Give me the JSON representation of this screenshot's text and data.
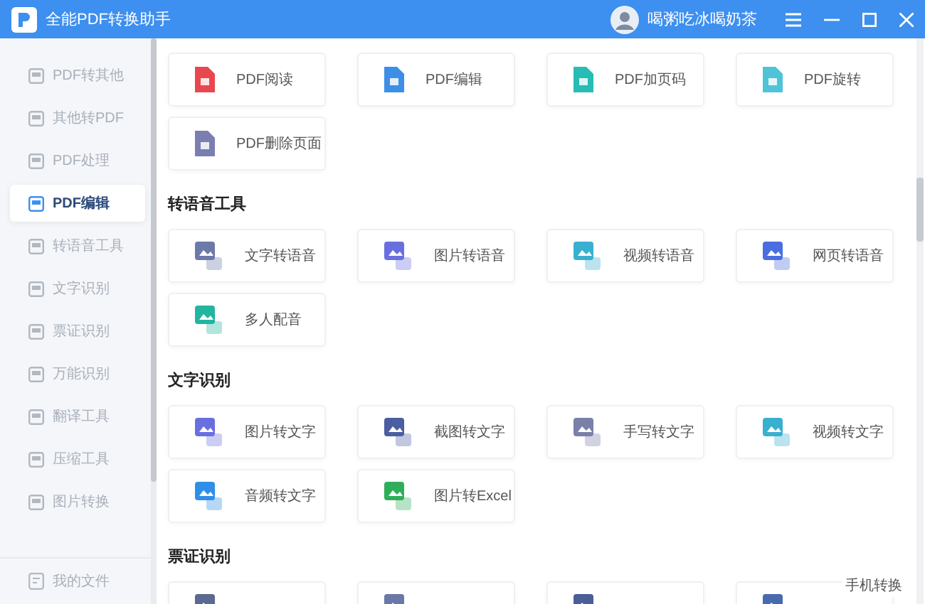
{
  "window": {
    "title": "全能PDF转换助手",
    "user": "喝粥吃冰喝奶茶"
  },
  "sidebar": {
    "items": [
      {
        "label": "PDF转其他",
        "selected": false
      },
      {
        "label": "其他转PDF",
        "selected": false
      },
      {
        "label": "PDF处理",
        "selected": false
      },
      {
        "label": "PDF编辑",
        "selected": true
      },
      {
        "label": "转语音工具",
        "selected": false
      },
      {
        "label": "文字识别",
        "selected": false
      },
      {
        "label": "票证识别",
        "selected": false
      },
      {
        "label": "万能识别",
        "selected": false
      },
      {
        "label": "翻译工具",
        "selected": false
      },
      {
        "label": "压缩工具",
        "selected": false
      },
      {
        "label": "图片转换",
        "selected": false
      }
    ],
    "footer": "我的文件"
  },
  "sections": [
    {
      "tools": [
        {
          "label": "PDF阅读",
          "kind": "document",
          "color": "#e8484d"
        },
        {
          "label": "PDF编辑",
          "kind": "document",
          "color": "#3d8fe6"
        },
        {
          "label": "PDF加页码",
          "kind": "document",
          "color": "#27bcb4"
        },
        {
          "label": "PDF旋转",
          "kind": "document",
          "color": "#4fc3d8"
        },
        {
          "label": "PDF删除页面",
          "kind": "document",
          "color": "#7a7fb0"
        }
      ]
    },
    {
      "heading": "转语音工具",
      "tools": [
        {
          "label": "文字转语音",
          "kind": "converter",
          "color": "#6b7aa8"
        },
        {
          "label": "图片转语音",
          "kind": "converter",
          "color": "#6a6fe0"
        },
        {
          "label": "视频转语音",
          "kind": "converter",
          "color": "#3ab0d0"
        },
        {
          "label": "网页转语音",
          "kind": "converter",
          "color": "#4a6ee0"
        },
        {
          "label": "多人配音",
          "kind": "converter",
          "color": "#22b5a0"
        }
      ]
    },
    {
      "heading": "文字识别",
      "tools": [
        {
          "label": "图片转文字",
          "kind": "converter",
          "color": "#6a6fe0"
        },
        {
          "label": "截图转文字",
          "kind": "converter",
          "color": "#4a5ea0"
        },
        {
          "label": "手写转文字",
          "kind": "converter",
          "color": "#7a80a8"
        },
        {
          "label": "视频转文字",
          "kind": "converter",
          "color": "#3ab0d0"
        },
        {
          "label": "音频转文字",
          "kind": "converter",
          "color": "#2f8fe8"
        },
        {
          "label": "图片转Excel",
          "kind": "converter",
          "color": "#2fae5a"
        }
      ]
    },
    {
      "heading": "票证识别",
      "tools": [
        {
          "kind": "converter",
          "color": "#5a6a90"
        },
        {
          "kind": "converter",
          "color": "#6a78a8"
        },
        {
          "kind": "converter",
          "color": "#4a5e98"
        },
        {
          "kind": "converter",
          "color": "#4a6ab0"
        }
      ]
    }
  ],
  "floating_button": "手机转换"
}
